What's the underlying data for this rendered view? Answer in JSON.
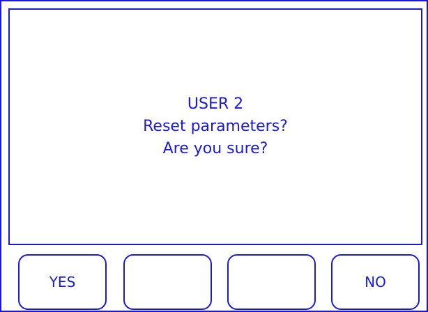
{
  "dialog": {
    "line1": "USER 2",
    "line2": "Reset parameters?",
    "line3": "Are you sure?"
  },
  "softkeys": [
    {
      "label": "YES"
    },
    {
      "label": ""
    },
    {
      "label": ""
    },
    {
      "label": "NO"
    }
  ],
  "colors": {
    "accent": "#1a1ad6",
    "background": "#ffffff"
  }
}
